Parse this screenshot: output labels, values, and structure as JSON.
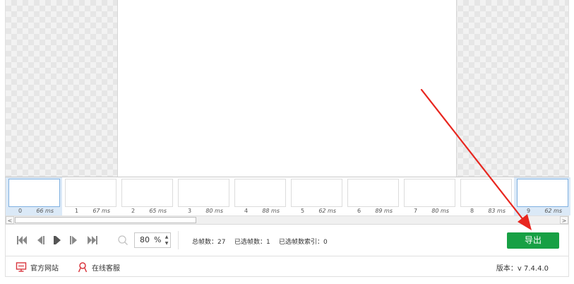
{
  "timeline": {
    "frames": [
      {
        "index": "0",
        "duration": "66 ms",
        "selected": true
      },
      {
        "index": "1",
        "duration": "67 ms",
        "selected": false
      },
      {
        "index": "2",
        "duration": "65 ms",
        "selected": false
      },
      {
        "index": "3",
        "duration": "80 ms",
        "selected": false
      },
      {
        "index": "4",
        "duration": "88 ms",
        "selected": false
      },
      {
        "index": "5",
        "duration": "62 ms",
        "selected": false
      },
      {
        "index": "6",
        "duration": "89 ms",
        "selected": false
      },
      {
        "index": "7",
        "duration": "80 ms",
        "selected": false
      },
      {
        "index": "8",
        "duration": "83 ms",
        "selected": false
      },
      {
        "index": "9",
        "duration": "62 ms",
        "selected": true
      }
    ],
    "scroll_left": "<",
    "scroll_right": ">"
  },
  "controls": {
    "icons": [
      "skip-to-first-icon",
      "previous-frame-icon",
      "play-icon",
      "next-frame-icon",
      "skip-to-last-icon",
      "zoom-icon"
    ],
    "zoom": {
      "value": "80",
      "unit": "%",
      "up": "▲",
      "down": "▼"
    },
    "stats": {
      "total_frames": "总帧数：27",
      "selected_frames": "已选帧数：1",
      "selected_index": "已选帧数索引：0"
    },
    "export_label": "导出"
  },
  "footer": {
    "website_label": "官方网站",
    "support_label": "在线客服",
    "version": "版本：v 7.4.4.0"
  },
  "colors": {
    "accent_green": "#17a044",
    "annotation_red": "#e8261f",
    "footer_icon_red": "#d9363e"
  }
}
